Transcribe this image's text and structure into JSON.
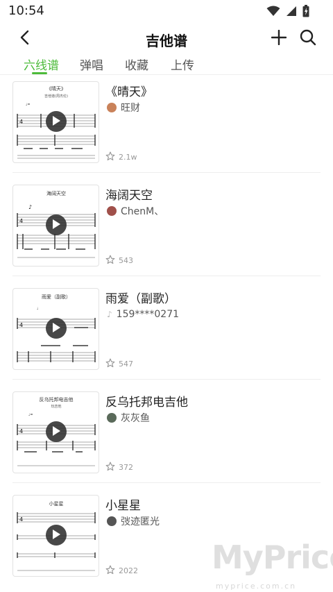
{
  "status_bar": {
    "time": "10:54",
    "icons": [
      "wifi-icon",
      "signal-icon",
      "battery-icon"
    ]
  },
  "header": {
    "title": "吉他谱",
    "back_icon": "chevron-left-icon",
    "add_icon": "plus-icon",
    "search_icon": "search-icon"
  },
  "tabs": [
    {
      "label": "六线谱",
      "active": true
    },
    {
      "label": "弹唱",
      "active": false
    },
    {
      "label": "收藏",
      "active": false
    },
    {
      "label": "上传",
      "active": false
    }
  ],
  "colors": {
    "accent": "#4cbb3a",
    "text_primary": "#222222",
    "text_secondary": "#555555",
    "text_muted": "#999999",
    "divider": "#eeeeee"
  },
  "songs": [
    {
      "title": "《晴天》",
      "author": "旺财",
      "favorites": "2.1w",
      "avatar_color": "#c9825a",
      "thumb_title": "《晴天》",
      "thumb_subtitle": "吉他谱(周杰伦)"
    },
    {
      "title": "海阔天空",
      "author": "ChenM、",
      "favorites": "543",
      "avatar_color": "#a0504a",
      "thumb_title": "海阔天空",
      "thumb_subtitle": ""
    },
    {
      "title": "雨爱（副歌）",
      "author": "159****0271",
      "favorites": "547",
      "avatar_color": "#cfcfcf",
      "thumb_title": "雨爱（副歌）",
      "thumb_subtitle": ""
    },
    {
      "title": "反乌托邦电吉他",
      "author": "灰灰鱼",
      "favorites": "372",
      "avatar_color": "#5a6a5a",
      "thumb_title": "反乌托邦电吉他",
      "thumb_subtitle": "玩吉他"
    },
    {
      "title": "小星星",
      "author": "弢迹匿光",
      "favorites": "2022",
      "avatar_color": "#555555",
      "thumb_title": "小星星",
      "thumb_subtitle": ""
    }
  ],
  "watermark": {
    "brand": "MyPrice",
    "url": "myprice.com.cn"
  }
}
